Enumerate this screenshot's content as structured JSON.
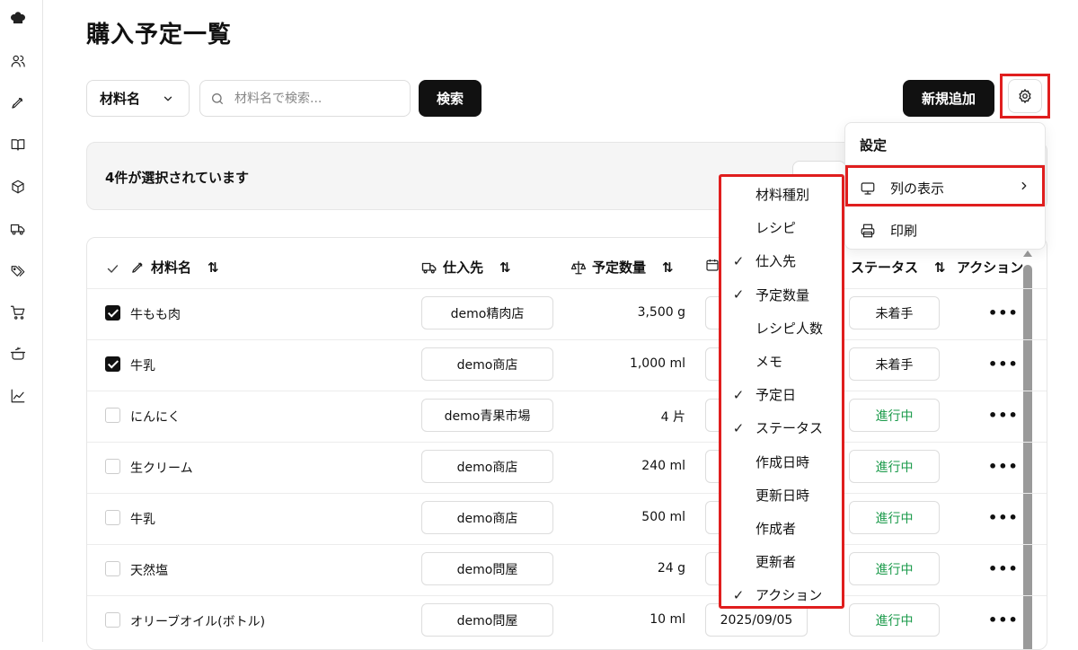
{
  "sidebar": {
    "icons": [
      "chef-hat-icon",
      "users-icon",
      "pen-icon",
      "book-icon",
      "box-icon",
      "truck-icon",
      "tags-icon",
      "cart-icon",
      "cooking-pot-icon",
      "chart-icon"
    ]
  },
  "page": {
    "title": "購入予定一覧"
  },
  "toolbar": {
    "filter_label": "材料名",
    "search_placeholder": "材料名で検索...",
    "search_label": "検索",
    "add_label": "新規追加"
  },
  "selection": {
    "text": "4件が選択されています"
  },
  "table": {
    "headers": {
      "material": "材料名",
      "supplier": "仕入先",
      "quantity": "予定数量",
      "status": "ステータス",
      "action": "アクション"
    },
    "rows": [
      {
        "checked": true,
        "material": "牛もも肉",
        "supplier": "demo精肉店",
        "quantity": "3,500 g",
        "date": "",
        "status": "未着手"
      },
      {
        "checked": true,
        "material": "牛乳",
        "supplier": "demo商店",
        "quantity": "1,000 ml",
        "date": "",
        "status": "未着手"
      },
      {
        "checked": false,
        "material": "にんにく",
        "supplier": "demo青果市場",
        "quantity": "4 片",
        "date": "",
        "status": "進行中"
      },
      {
        "checked": false,
        "material": "生クリーム",
        "supplier": "demo商店",
        "quantity": "240 ml",
        "date": "",
        "status": "進行中"
      },
      {
        "checked": false,
        "material": "牛乳",
        "supplier": "demo商店",
        "quantity": "500 ml",
        "date": "",
        "status": "進行中"
      },
      {
        "checked": false,
        "material": "天然塩",
        "supplier": "demo問屋",
        "quantity": "24 g",
        "date": "",
        "status": "進行中"
      },
      {
        "checked": false,
        "material": "オリーブオイル(ボトル)",
        "supplier": "demo問屋",
        "quantity": "10 ml",
        "date": "2025/09/05",
        "status": "進行中"
      }
    ],
    "row_action": "•••"
  },
  "settings_menu": {
    "title": "設定",
    "columns_label": "列の表示",
    "print_label": "印刷"
  },
  "column_menu": {
    "items": [
      {
        "label": "材料種別",
        "checked": false
      },
      {
        "label": "レシピ",
        "checked": false
      },
      {
        "label": "仕入先",
        "checked": true
      },
      {
        "label": "予定数量",
        "checked": true
      },
      {
        "label": "レシピ人数",
        "checked": false
      },
      {
        "label": "メモ",
        "checked": false
      },
      {
        "label": "予定日",
        "checked": true
      },
      {
        "label": "ステータス",
        "checked": true
      },
      {
        "label": "作成日時",
        "checked": false
      },
      {
        "label": "更新日時",
        "checked": false
      },
      {
        "label": "作成者",
        "checked": false
      },
      {
        "label": "更新者",
        "checked": false
      },
      {
        "label": "アクション",
        "checked": true
      }
    ]
  },
  "colors": {
    "highlight": "#e01e1e",
    "progress": "#1a9a4a",
    "dark_button": "#111111"
  }
}
